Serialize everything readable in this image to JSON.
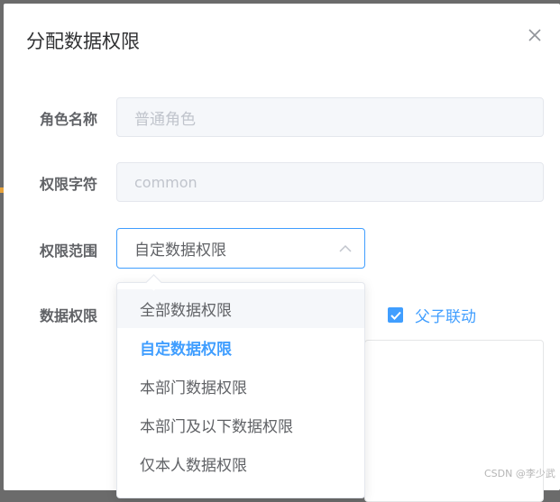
{
  "dialog": {
    "title": "分配数据权限"
  },
  "form": {
    "role_name": {
      "label": "角色名称",
      "value": "普通角色"
    },
    "permission_char": {
      "label": "权限字符",
      "value": "common"
    },
    "scope": {
      "label": "权限范围",
      "value": "自定数据权限"
    },
    "data_permission": {
      "label": "数据权限",
      "linkage_label": "父子联动",
      "linkage_checked": true
    }
  },
  "dropdown": {
    "options": [
      {
        "label": "全部数据权限",
        "state": "hover"
      },
      {
        "label": "自定数据权限",
        "state": "selected"
      },
      {
        "label": "本部门数据权限",
        "state": "normal"
      },
      {
        "label": "本部门及以下数据权限",
        "state": "normal"
      },
      {
        "label": "仅本人数据权限",
        "state": "normal"
      }
    ]
  },
  "watermark": "CSDN @李少武",
  "colors": {
    "primary": "#409eff",
    "text": "#606266",
    "placeholder": "#c0c4cc",
    "disabled_bg": "#f5f7fa"
  }
}
